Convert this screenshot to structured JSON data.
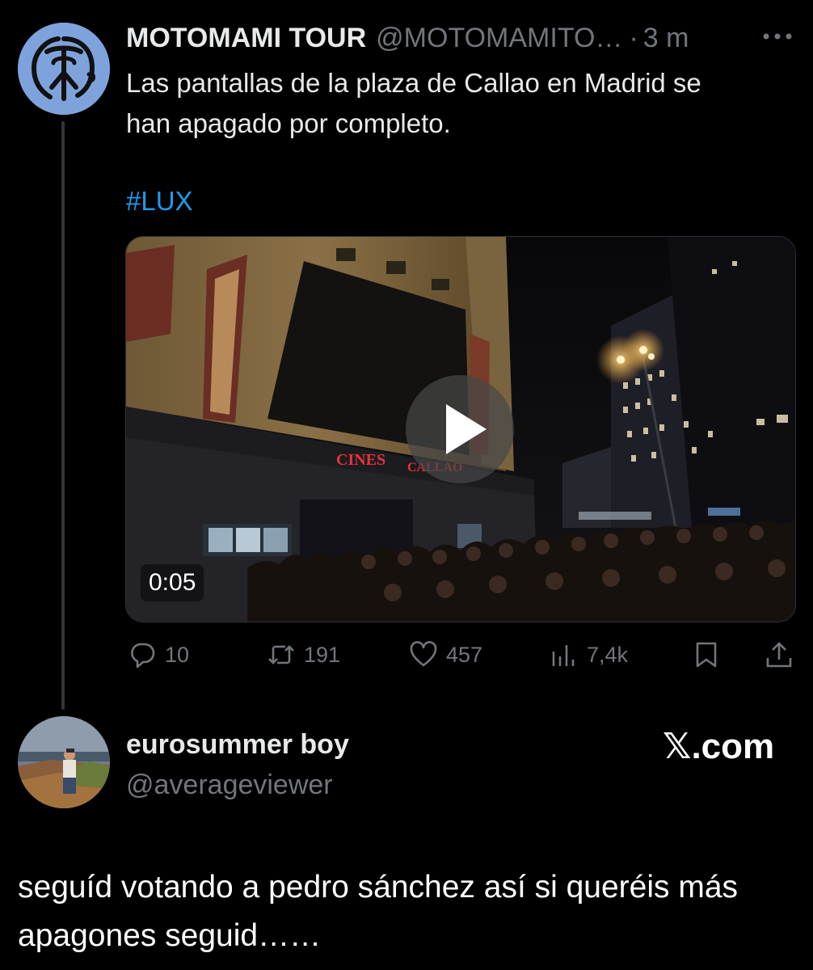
{
  "quoted_tweet": {
    "display_name": "MOTOMAMI TOUR",
    "handle": "@MOTOMAMITO…",
    "separator": "·",
    "time": "3 m",
    "text_lines": [
      "Las pantallas de la plaza de Callao en Madrid se",
      "han apagado por completo."
    ],
    "hashtag": "#LUX",
    "media": {
      "duration": "0:05",
      "sign_left": "CINES",
      "sign_right": "CALLAO"
    },
    "actions": {
      "replies": "10",
      "reposts": "191",
      "likes": "457",
      "views": "7,4k"
    },
    "icons": {
      "more": "more-horizontal-icon",
      "reply": "reply-bubble-icon",
      "repost": "repost-icon",
      "like": "heart-icon",
      "views": "views-bar-chart-icon",
      "bookmark": "bookmark-icon",
      "share": "share-upload-icon"
    },
    "colors": {
      "avatar_bg": "#7ea3dc",
      "hashtag": "#1d9bf0",
      "muted": "#71767b"
    }
  },
  "reply": {
    "display_name": "eurosummer boy",
    "handle": "@averageviewer",
    "watermark": "𝕏.com",
    "text": "seguíd votando a pedro sánchez así si queréis más apagones seguid……"
  }
}
